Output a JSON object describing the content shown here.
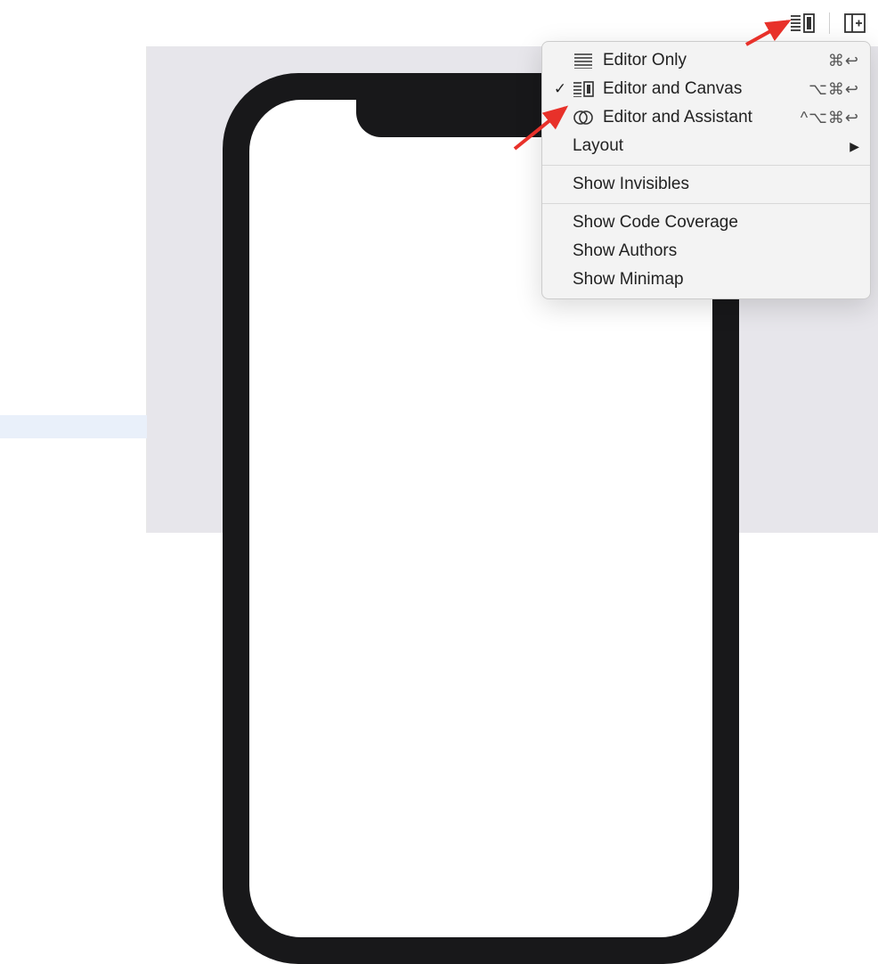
{
  "toolbar": {
    "editor_options_button": "editor-options",
    "inspector_button": "add-inspector"
  },
  "menu": {
    "editor_only": {
      "label": "Editor Only",
      "shortcut": "⌘↩"
    },
    "editor_and_canvas": {
      "label": "Editor and Canvas",
      "shortcut": "⌥⌘↩",
      "checked": true
    },
    "editor_and_assistant": {
      "label": "Editor and Assistant",
      "shortcut": "^⌥⌘↩"
    },
    "layout": {
      "label": "Layout"
    },
    "show_invisibles": {
      "label": "Show Invisibles"
    },
    "show_code_coverage": {
      "label": "Show Code Coverage"
    },
    "show_authors": {
      "label": "Show Authors"
    },
    "show_minimap": {
      "label": "Show Minimap"
    }
  }
}
